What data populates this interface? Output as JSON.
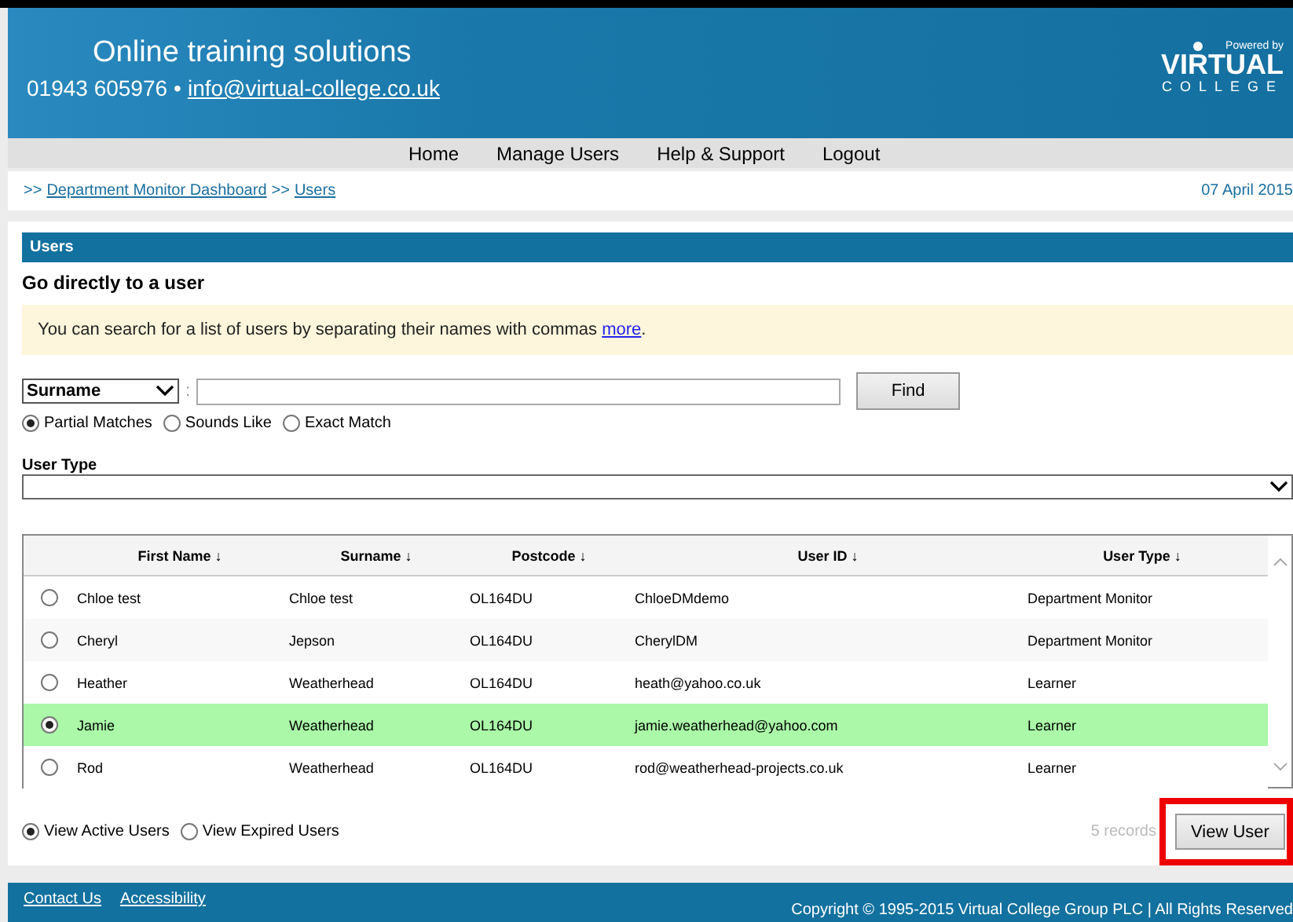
{
  "header": {
    "title": "Online training solutions",
    "phone": "01943 605976",
    "separator": "•",
    "email": "info@virtual-college.co.uk",
    "logo": {
      "powered_by": "Powered by",
      "brand": "VIRTUAL",
      "sub": "COLLEGE"
    }
  },
  "nav": [
    "Home",
    "Manage Users",
    "Help & Support",
    "Logout"
  ],
  "breadcrumb": {
    "prefix": ">>",
    "items": [
      {
        "label": "Department Monitor Dashboard"
      },
      {
        "label": "Users"
      }
    ],
    "date": "07 April 2015"
  },
  "panel": {
    "title": "Users",
    "heading": "Go directly to a user",
    "notice": "You can search for a list of users by separating their names with commas",
    "notice_link": "more",
    "notice_end": ".",
    "search": {
      "field": "Surname",
      "colon": ":",
      "button": "Find",
      "modes": [
        {
          "label": "Partial Matches",
          "selected": true
        },
        {
          "label": "Sounds Like",
          "selected": false
        },
        {
          "label": "Exact Match",
          "selected": false
        }
      ]
    },
    "user_type": {
      "label": "User Type"
    },
    "table": {
      "columns": [
        "First Name ↓",
        "Surname ↓",
        "Postcode ↓",
        "User ID ↓",
        "User Type ↓"
      ],
      "rows": [
        {
          "selected": false,
          "cells": [
            "Chloe test",
            "Chloe test",
            "OL164DU",
            "ChloeDMdemo",
            "Department Monitor"
          ]
        },
        {
          "selected": false,
          "cells": [
            "Cheryl",
            "Jepson",
            "OL164DU",
            "CherylDM",
            "Department Monitor"
          ]
        },
        {
          "selected": false,
          "cells": [
            "Heather",
            "Weatherhead",
            "OL164DU",
            "heath@yahoo.co.uk",
            "Learner"
          ]
        },
        {
          "selected": true,
          "cells": [
            "Jamie",
            "Weatherhead",
            "OL164DU",
            "jamie.weatherhead@yahoo.com",
            "Learner"
          ]
        },
        {
          "selected": false,
          "cells": [
            "Rod",
            "Weatherhead",
            "OL164DU",
            "rod@weatherhead-projects.co.uk",
            "Learner"
          ]
        }
      ]
    },
    "filters": [
      {
        "label": "View Active Users",
        "selected": true
      },
      {
        "label": "View Expired Users",
        "selected": false
      }
    ],
    "record_count": "5 records",
    "view_button": {
      "label": "View User",
      "highlighted": true
    }
  },
  "footer": {
    "links": [
      "Contact Us",
      "Accessibility"
    ],
    "copyright": "Copyright © 1995-2015 Virtual College Group PLC | All Rights Reserved"
  }
}
